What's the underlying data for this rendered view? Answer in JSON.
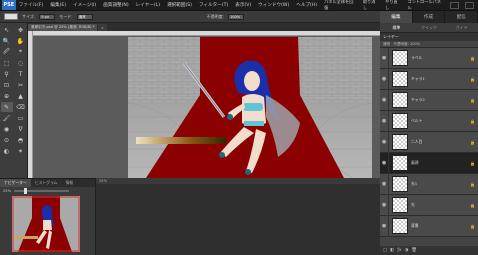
{
  "app": {
    "logo": "PSE"
  },
  "menu": {
    "items": [
      "ファイル(F)",
      "編集(E)",
      "イメージ(I)",
      "画質調整(N)",
      "レイヤー(L)",
      "選択範囲(S)",
      "フィルター(T)",
      "表示(V)",
      "ウィンドウ(W)",
      "ヘルプ(H)"
    ],
    "right": [
      "パネル全体を回復",
      "取り消し",
      "やり直し",
      "コントロールパネル"
    ]
  },
  "options": {
    "size_label": "サイズ:",
    "size_value": "9 px",
    "mode_label": "モード:",
    "mode_value": "通常",
    "opacity_label": "不透明度:",
    "opacity_value": "100%"
  },
  "right_tabs": {
    "tabs": [
      "編集",
      "作成",
      "配信"
    ],
    "active": 0
  },
  "sub_tabs": {
    "tabs": [
      "標準",
      "クイック",
      "ガイド"
    ],
    "active": 0
  },
  "tools": [
    "↖",
    "✥",
    "🔍",
    "✋",
    "🖉",
    "⌖",
    "⬚",
    "◌",
    "⚲",
    "T",
    "⊡",
    "✂",
    "⊕",
    "▲",
    "✎",
    "⌫",
    "🖌",
    "▭",
    "◉",
    "∇",
    "⊙",
    "◓",
    "◐",
    "✶"
  ],
  "doc_tabs": [
    {
      "label": "風邪引き.psd @ 25% (風邪, RGB/8) *",
      "active": true
    },
    {
      "label": "x",
      "active": false
    }
  ],
  "colors": {
    "foreground": "#e2c279",
    "background": "#f4ead8",
    "accent": "#2a6fc3",
    "carpet": "#8b0000"
  },
  "navigator": {
    "tabs": [
      "ナビゲーター",
      "ヒストグラム",
      "情報"
    ],
    "active": 0,
    "zoom_label": "25%"
  },
  "status": {
    "text": "25%"
  },
  "layers": {
    "title": "レイヤー",
    "mode": "通常",
    "opacity": "不透明度: 100%",
    "items": [
      {
        "name": "ラベル",
        "selected": false
      },
      {
        "name": "キャラ1",
        "selected": false
      },
      {
        "name": "キャラ2",
        "selected": false
      },
      {
        "name": "ベルト",
        "selected": false
      },
      {
        "name": "二人目",
        "selected": false
      },
      {
        "name": "風邪",
        "selected": true
      },
      {
        "name": "光1",
        "selected": false
      },
      {
        "name": "光",
        "selected": false
      },
      {
        "name": "背景",
        "selected": false
      }
    ],
    "footer": [
      "□",
      "◧",
      "ƒx",
      "◑",
      "🗑"
    ]
  }
}
